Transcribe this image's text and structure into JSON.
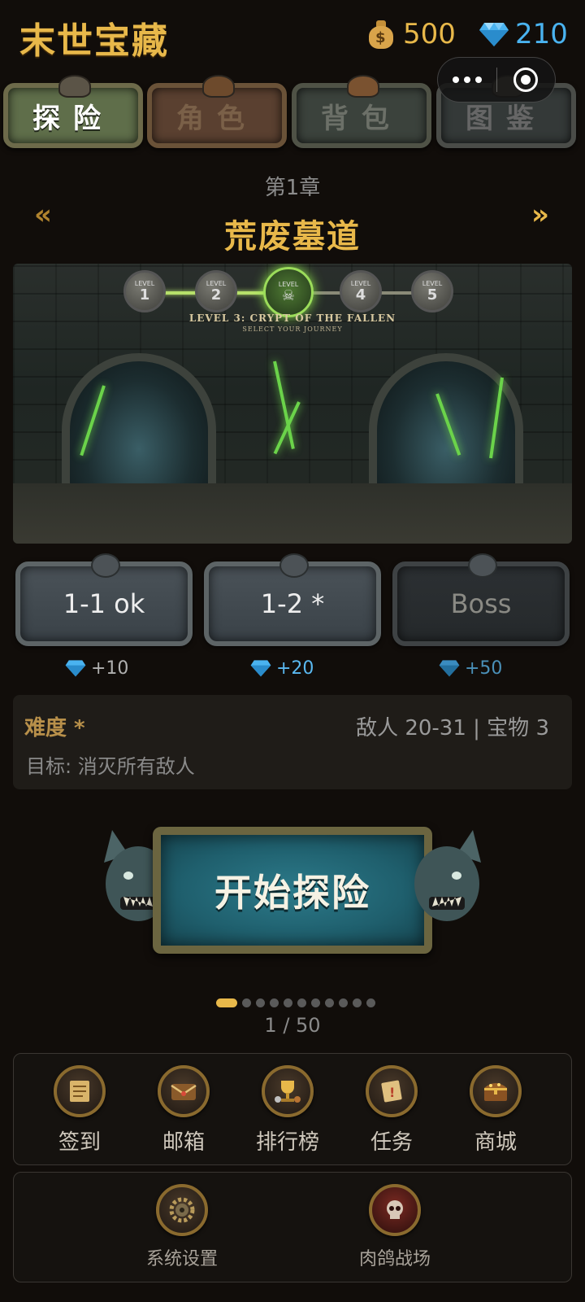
{
  "header": {
    "title": "末世宝藏",
    "coins": "500",
    "gems": "210"
  },
  "tabs": [
    {
      "label": "探险"
    },
    {
      "label": "角色"
    },
    {
      "label": "背包"
    },
    {
      "label": "图鉴"
    }
  ],
  "chapter": {
    "number": "第1章",
    "name": "荒废墓道",
    "prev_icon": "«",
    "next_icon": "»"
  },
  "banner": {
    "levels": [
      "1",
      "2",
      "3",
      "4",
      "5"
    ],
    "level_caption": "LEVEL",
    "title": "LEVEL 3: CRYPT OF THE FALLEN",
    "subtitle": "SELECT YOUR JOURNEY"
  },
  "stages": [
    {
      "label": "1-1 ok",
      "reward": "+10"
    },
    {
      "label": "1-2 *",
      "reward": "+20"
    },
    {
      "label": "Boss",
      "reward": "+50"
    }
  ],
  "info": {
    "difficulty": "难度 *",
    "enemies": "敌人 20-31 | 宝物 3",
    "goal": "目标: 消灭所有敌人"
  },
  "start_button": {
    "label": "开始探险"
  },
  "pager": {
    "current": 1,
    "total_dots": 11,
    "text": "1 / 50"
  },
  "menu1": [
    {
      "label": "签到",
      "icon": "calendar-scroll-icon"
    },
    {
      "label": "邮箱",
      "icon": "mail-chest-icon"
    },
    {
      "label": "排行榜",
      "icon": "trophy-icon"
    },
    {
      "label": "任务",
      "icon": "quest-scroll-icon"
    },
    {
      "label": "商城",
      "icon": "treasure-chest-icon"
    }
  ],
  "menu2": [
    {
      "label": "系统设置",
      "icon": "gear-icon"
    },
    {
      "label": "肉鸽战场",
      "icon": "skull-arena-icon"
    }
  ],
  "colors": {
    "gold": "#e8b84a",
    "gem_blue": "#4ab3f0",
    "background": "#110d0a"
  }
}
